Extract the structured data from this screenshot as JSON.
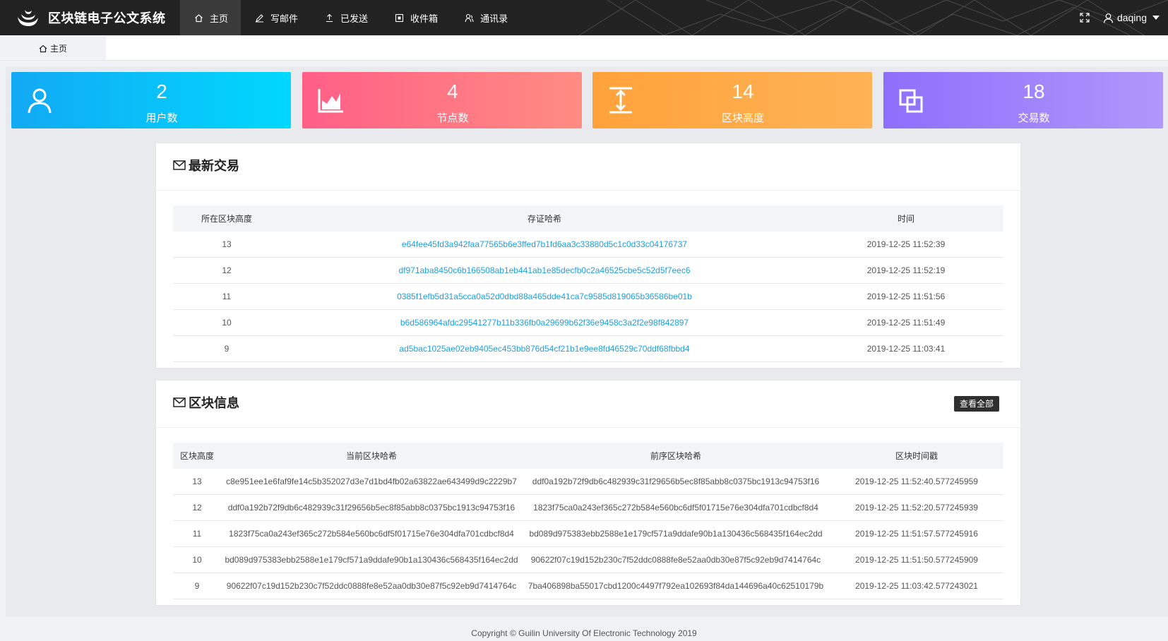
{
  "app": {
    "title": "区块链电子公文系统"
  },
  "nav": [
    {
      "label": "主页",
      "icon": "home-icon",
      "active": true
    },
    {
      "label": "写邮件",
      "icon": "edit-icon"
    },
    {
      "label": "已发送",
      "icon": "upload-icon"
    },
    {
      "label": "收件箱",
      "icon": "inbox-icon"
    },
    {
      "label": "通讯录",
      "icon": "contacts-icon"
    }
  ],
  "user": {
    "name": "daqing"
  },
  "tab": {
    "label": "主页"
  },
  "stats": [
    {
      "value": "2",
      "label": "用户数",
      "icon": "user-icon",
      "color": "#12a9f4"
    },
    {
      "value": "4",
      "label": "节点数",
      "icon": "area-chart-icon",
      "color": "#ff5f86"
    },
    {
      "value": "14",
      "label": "区块高度",
      "icon": "height-icon",
      "color": "#ffa23b"
    },
    {
      "value": "18",
      "label": "交易数",
      "icon": "layers-icon",
      "color": "#8e6ffd"
    }
  ],
  "transactions": {
    "title": "最新交易",
    "columns": [
      "所在区块高度",
      "存证哈希",
      "时间"
    ],
    "rows": [
      [
        "13",
        "e64fee45fd3a942faa77565b6e3ffed7b1fd6aa3c33880d5c1c0d33c04176737",
        "2019-12-25 11:52:39"
      ],
      [
        "12",
        "df971aba8450c6b166508ab1eb441ab1e85decfb0c2a46525cbe5c52d5f7eec6",
        "2019-12-25 11:52:19"
      ],
      [
        "11",
        "0385f1efb5d31a5cca0a52d0dbd88a465dde41ca7c9585d819065b36586be01b",
        "2019-12-25 11:51:56"
      ],
      [
        "10",
        "b6d586964afdc29541277b11b336fb0a29699b62f36e9458c3a2f2e98f842897",
        "2019-12-25 11:51:49"
      ],
      [
        "9",
        "ad5bac1025ae02eb9405ec453bb876d54cf21b1e9ee8fd46529c70ddf68fbbd4",
        "2019-12-25 11:03:41"
      ]
    ]
  },
  "blocks": {
    "title": "区块信息",
    "view_all": "查看全部",
    "columns": [
      "区块高度",
      "当前区块哈希",
      "前序区块哈希",
      "区块时间戳"
    ],
    "rows": [
      [
        "13",
        "c8e951ee1e6faf9fe14c5b352027d3e7d1bd4fb02a63822ae643499d9c2229b7",
        "ddf0a192b72f9db6c482939c31f29656b5ec8f85abb8c0375bc1913c94753f16",
        "2019-12-25 11:52:40.577245959"
      ],
      [
        "12",
        "ddf0a192b72f9db6c482939c31f29656b5ec8f85abb8c0375bc1913c94753f16",
        "1823f75ca0a243ef365c272b584e560bc6df5f01715e76e304dfa701cdbcf8d4",
        "2019-12-25 11:52:20.577245939"
      ],
      [
        "11",
        "1823f75ca0a243ef365c272b584e560bc6df5f01715e76e304dfa701cdbcf8d4",
        "bd089d975383ebb2588e1e179cf571a9ddafe90b1a130436c568435f164ec2dd",
        "2019-12-25 11:51:57.577245916"
      ],
      [
        "10",
        "bd089d975383ebb2588e1e179cf571a9ddafe90b1a130436c568435f164ec2dd",
        "90622f07c19d152b230c7f52ddc0888fe8e52aa0db30e87f5c92eb9d7414764c",
        "2019-12-25 11:51:50.577245909"
      ],
      [
        "9",
        "90622f07c19d152b230c7f52ddc0888fe8e52aa0db30e87f5c92eb9d7414764c",
        "7ba406898ba55017cbd1200c4497f792ea102693f84da144696a40c62510179b",
        "2019-12-25 11:03:42.577243021"
      ]
    ]
  },
  "footer": {
    "text": "Copyright © Guilin University Of Electronic Technology 2019"
  }
}
